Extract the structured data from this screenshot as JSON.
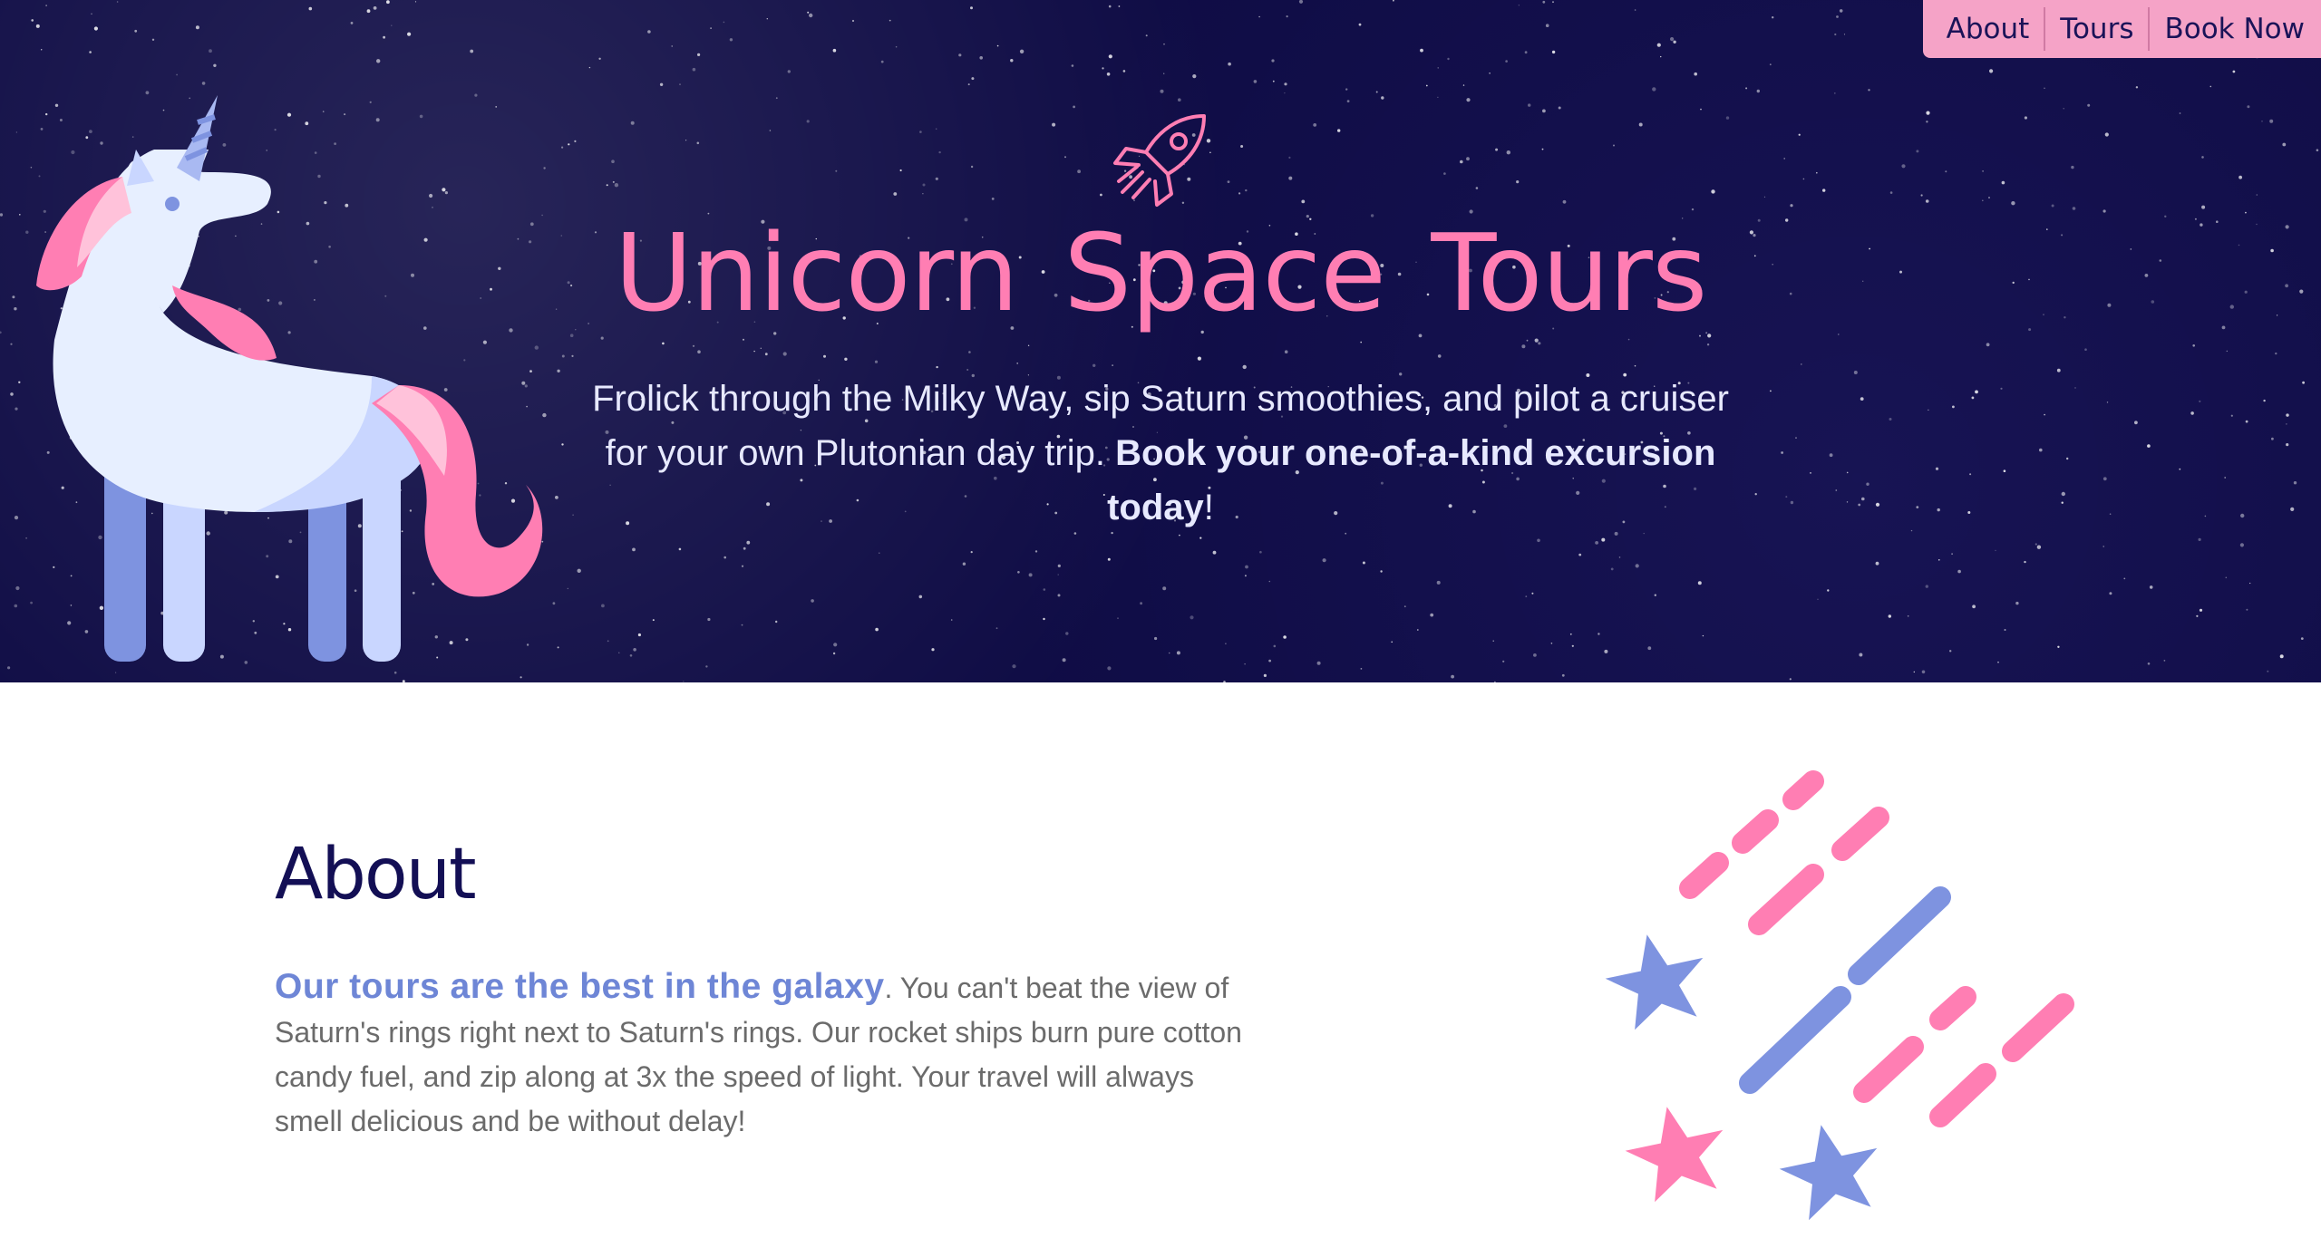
{
  "nav": {
    "items": [
      {
        "label": "About"
      },
      {
        "label": "Tours"
      },
      {
        "label": "Book Now"
      }
    ]
  },
  "hero": {
    "title": "Unicorn Space Tours",
    "intro_text": "Frolick through the Milky Way, sip Saturn smoothies, and pilot a cruiser for your own Plutonian day trip. ",
    "intro_emphasis": "Book your one-of-a-kind excursion today",
    "intro_end": "!"
  },
  "about": {
    "heading": "About",
    "lead": "Our tours are the best in the galaxy",
    "body": ". You can't beat the view of Saturn's rings right next to Saturn's rings. Our rocket ships burn pure cotton candy fuel, and zip along at 3x the speed of light. Your travel will always smell delicious and be without delay!"
  },
  "icons": {
    "rocket": "rocket-icon",
    "unicorn": "unicorn-illustration",
    "shooting_stars": "shooting-stars-illustration"
  },
  "colors": {
    "hero_bg": "#0f0c45",
    "pink": "#ff7eb3",
    "nav_bg": "#f5a3c7",
    "navy": "#130f55",
    "periwinkle": "#6e86d6"
  }
}
